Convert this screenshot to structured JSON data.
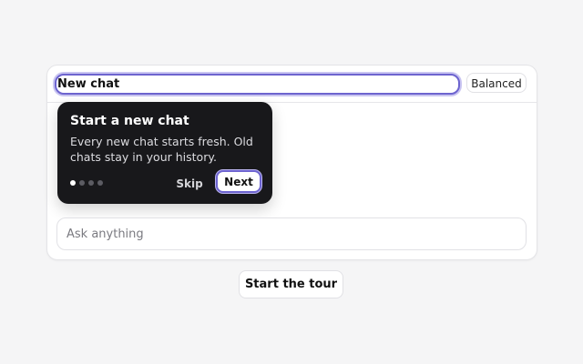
{
  "chat": {
    "title_value": "New chat",
    "mode_label": "Balanced"
  },
  "tour_tooltip": {
    "title": "Start a new chat",
    "body": "Every new chat starts fresh. Old chats stay in your history.",
    "step_current": 1,
    "step_total": 4,
    "skip_label": "Skip",
    "next_label": "Next"
  },
  "composer": {
    "placeholder": "Ask anything",
    "value": ""
  },
  "start_tour_label": "Start the tour",
  "colors": {
    "accent": "#6d64cf",
    "tooltip_bg": "#18181b",
    "page_bg": "#f5f5f6"
  }
}
